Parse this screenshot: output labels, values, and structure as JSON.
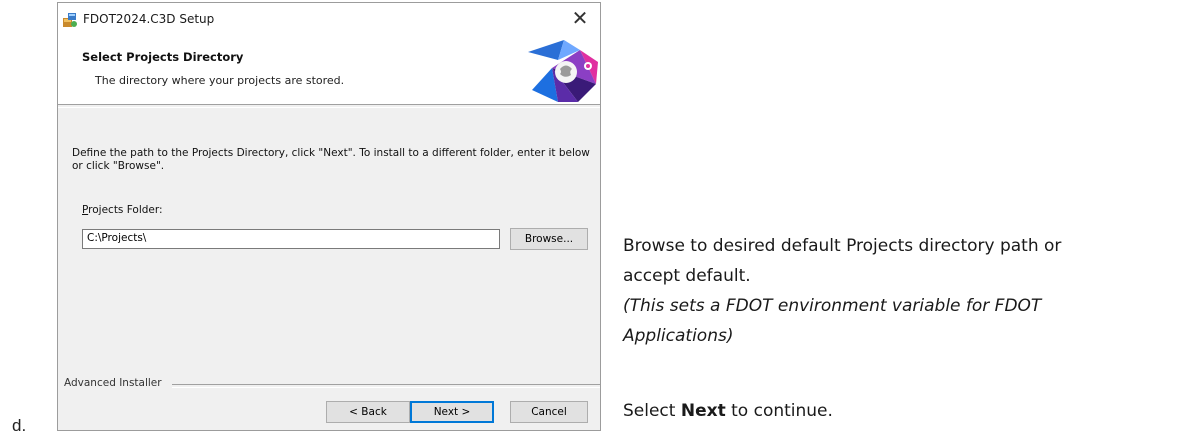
{
  "list_marker": "d.",
  "dialog": {
    "title": "FDOT2024.C3D Setup",
    "close_glyph": "✕",
    "header": {
      "title": "Select Projects Directory",
      "subtitle": "The directory where your projects are stored."
    },
    "description": "Define the path to the Projects Directory, click \"Next\". To install to a different folder, enter it below or click \"Browse\".",
    "folder_label_mnemonic": "P",
    "folder_label_rest": "rojects Folder:",
    "folder_value": "C:\\Projects\\",
    "browse_label": "Browse...",
    "installer_label": "Advanced Installer",
    "back_label": "< Back",
    "next_label": "Next >",
    "cancel_label": "Cancel"
  },
  "instructions": {
    "line1": "Browse to desired default Projects directory path or",
    "line2": "accept default.",
    "line3": "(This sets a FDOT environment variable  for FDOT",
    "line4": "Applications)",
    "line5_prefix": "Select ",
    "line5_bold": "Next",
    "line5_suffix": " to continue."
  }
}
